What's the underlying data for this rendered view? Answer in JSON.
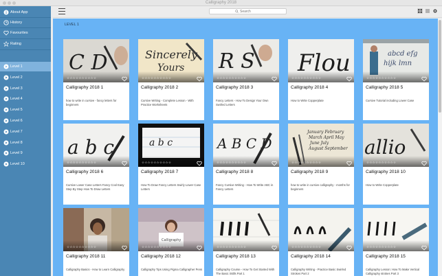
{
  "window": {
    "title": "Calligraphy 2018"
  },
  "sidebar": {
    "top_items": [
      {
        "label": "About App",
        "icon": "info-icon"
      },
      {
        "label": "History",
        "icon": "clock-icon"
      },
      {
        "label": "Favourites",
        "icon": "heart-icon"
      },
      {
        "label": "Rating",
        "icon": "star-icon"
      }
    ],
    "levels": [
      {
        "label": "Level 1",
        "active": true
      },
      {
        "label": "Level 2"
      },
      {
        "label": "Level 3"
      },
      {
        "label": "Level 4"
      },
      {
        "label": "Level 5"
      },
      {
        "label": "Level 6"
      },
      {
        "label": "Level 7"
      },
      {
        "label": "Level 8"
      },
      {
        "label": "Level 9"
      },
      {
        "label": "Level 10"
      }
    ]
  },
  "toolbar": {
    "search_placeholder": "Search"
  },
  "main": {
    "level_title": "LEVEL 1",
    "videos": [
      {
        "title": "Calligraphy 2018 1",
        "desc": "how to write in cursive - fancy letters for beginners",
        "stars": "☆☆☆☆☆☆☆☆☆☆",
        "thumb": "cd-pen"
      },
      {
        "title": "Calligraphy 2018 2",
        "desc": "Cursive Writing - Complete Lesson - With Practice Worksheets",
        "stars": "☆☆☆☆☆☆☆☆☆☆",
        "thumb": "sincerely"
      },
      {
        "title": "Calligraphy 2018 3",
        "desc": "Fancy Letters - How To Design Your Own Swirled Letters",
        "stars": "☆☆☆☆☆☆☆☆☆☆",
        "thumb": "rs"
      },
      {
        "title": "Calligraphy 2018 4",
        "desc": "How to Write Copperplate",
        "stars": "☆☆☆☆☆☆☆☆☆☆",
        "thumb": "flou"
      },
      {
        "title": "Calligraphy 2018 5",
        "desc": "Cursive Tutorial including Lower Case",
        "stars": "☆☆☆☆☆☆☆☆☆☆",
        "thumb": "whiteboard"
      },
      {
        "title": "Calligraphy 2018 6",
        "desc": "Cursive Lower Case Letters Fancy Cool Easy Step By Step How To Draw Letters",
        "stars": "☆☆☆☆☆☆☆☆☆☆",
        "thumb": "abc-marker"
      },
      {
        "title": "Calligraphy 2018 7",
        "desc": "How To Draw Fancy Letters Swirly Lower Case Letters",
        "stars": "☆☆☆☆☆☆☆☆☆☆",
        "thumb": "abc-lined"
      },
      {
        "title": "Calligraphy 2018 8",
        "desc": "Fancy Cursive Writing - How To Write ABC in Fancy Letters",
        "stars": "☆☆☆☆☆☆☆☆☆☆",
        "thumb": "fancy-abc"
      },
      {
        "title": "Calligraphy 2018 9",
        "desc": "how to write in cursive calligraphy - months for beginners",
        "stars": "☆☆☆☆☆☆☆☆☆☆",
        "thumb": "months"
      },
      {
        "title": "Calligraphy 2018 10",
        "desc": "How to Write Copperplate",
        "stars": "☆☆☆☆☆☆☆☆☆☆",
        "thumb": "callio"
      },
      {
        "title": "Calligraphy 2018 11",
        "desc": "Calligraphy Basics - How to Learn Calligraphy",
        "stars": "☆☆☆☆☆☆☆☆☆☆",
        "thumb": "woman1"
      },
      {
        "title": "Calligraphy 2018 12",
        "desc": "Calligraphy Tips Using Pigma Calligrapher Pens",
        "stars": "☆☆☆☆☆☆☆☆☆☆",
        "thumb": "woman2"
      },
      {
        "title": "Calligraphy 2018 13",
        "desc": "Calligraphy Course - How To Get Started With The Basic Skills Part 1",
        "stars": "☆☆☆☆☆☆☆☆☆☆",
        "thumb": "strokes1"
      },
      {
        "title": "Calligraphy 2018 14",
        "desc": "Calligraphy Writing - Practice Basic Swirled Strokes Part 2",
        "stars": "☆☆☆☆☆☆☆☆☆☆",
        "thumb": "strokes2"
      },
      {
        "title": "Calligraphy 2018 15",
        "desc": "Calligraphy Lesson: How To Make Vertical Calligraphy strokes Part 3",
        "stars": "☆☆☆☆☆☆☆☆☆☆",
        "thumb": "strokes3"
      }
    ]
  }
}
